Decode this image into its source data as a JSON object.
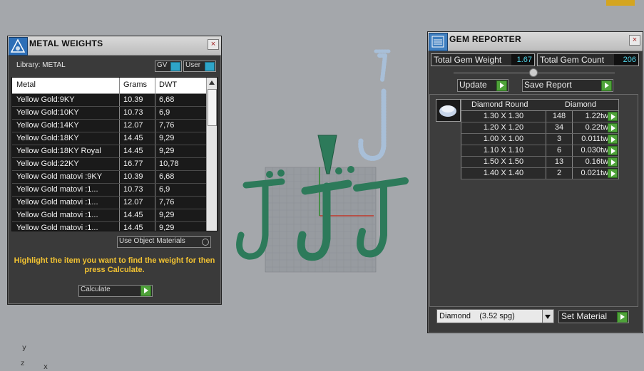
{
  "metal_weights": {
    "title": "METAL WEIGHTS",
    "close": "×",
    "library_label": "Library: METAL",
    "toggle_gv": "GV",
    "toggle_user": "User",
    "columns": [
      "Metal",
      "Grams",
      "DWT"
    ],
    "rows": [
      {
        "metal": "Yellow Gold:9KY",
        "grams": "10.39",
        "dwt": "6,68"
      },
      {
        "metal": "Yellow Gold:10KY",
        "grams": "10.73",
        "dwt": "6,9"
      },
      {
        "metal": "Yellow Gold:14KY",
        "grams": "12.07",
        "dwt": "7,76"
      },
      {
        "metal": "Yellow Gold:18KY",
        "grams": "14.45",
        "dwt": "9,29"
      },
      {
        "metal": "Yellow Gold:18KY Royal",
        "grams": "14.45",
        "dwt": "9,29"
      },
      {
        "metal": "Yellow Gold:22KY",
        "grams": "16.77",
        "dwt": "10,78"
      },
      {
        "metal": "Yellow Gold matovi :9KY",
        "grams": "10.39",
        "dwt": "6,68"
      },
      {
        "metal": "Yellow Gold matovi :1...",
        "grams": "10.73",
        "dwt": "6,9"
      },
      {
        "metal": "Yellow Gold matovi :1...",
        "grams": "12.07",
        "dwt": "7,76"
      },
      {
        "metal": "Yellow Gold matovi :1...",
        "grams": "14.45",
        "dwt": "9,29"
      },
      {
        "metal": "Yellow Gold matovi :1...",
        "grams": "14.45",
        "dwt": "9,29"
      }
    ],
    "use_object_materials": "Use Object Materials",
    "hint": "Highlight the item you want to find the weight for then press Calculate.",
    "calculate": "Calculate"
  },
  "gem_reporter": {
    "title": "GEM REPORTER",
    "close": "×",
    "total_weight_label": "Total Gem Weight",
    "total_weight_value": "1.67",
    "total_count_label": "Total Gem Count",
    "total_count_value": "206",
    "update": "Update",
    "save_report": "Save Report",
    "table_headers": [
      "Diamond Round",
      "Diamond"
    ],
    "rows": [
      {
        "size": "1.30 X 1.30",
        "count": "148",
        "weight": "1.22tw"
      },
      {
        "size": "1.20 X 1.20",
        "count": "34",
        "weight": "0.22tw"
      },
      {
        "size": "1.00 X 1.00",
        "count": "3",
        "weight": "0.011tw"
      },
      {
        "size": "1.10 X 1.10",
        "count": "6",
        "weight": "0.030tw"
      },
      {
        "size": "1.50 X 1.50",
        "count": "13",
        "weight": "0.16tw"
      },
      {
        "size": "1.40 X 1.40",
        "count": "2",
        "weight": "0.021tw"
      }
    ],
    "material": "Diamond    (3.52 spg)",
    "set_material": "Set Material"
  },
  "viewport": {
    "axis_y": "y",
    "axis_z": "z",
    "axis_x": "x",
    "letter_color": "#2d7a5a",
    "gem_color": "#a8bfd8",
    "background": "#a4a7ab"
  }
}
